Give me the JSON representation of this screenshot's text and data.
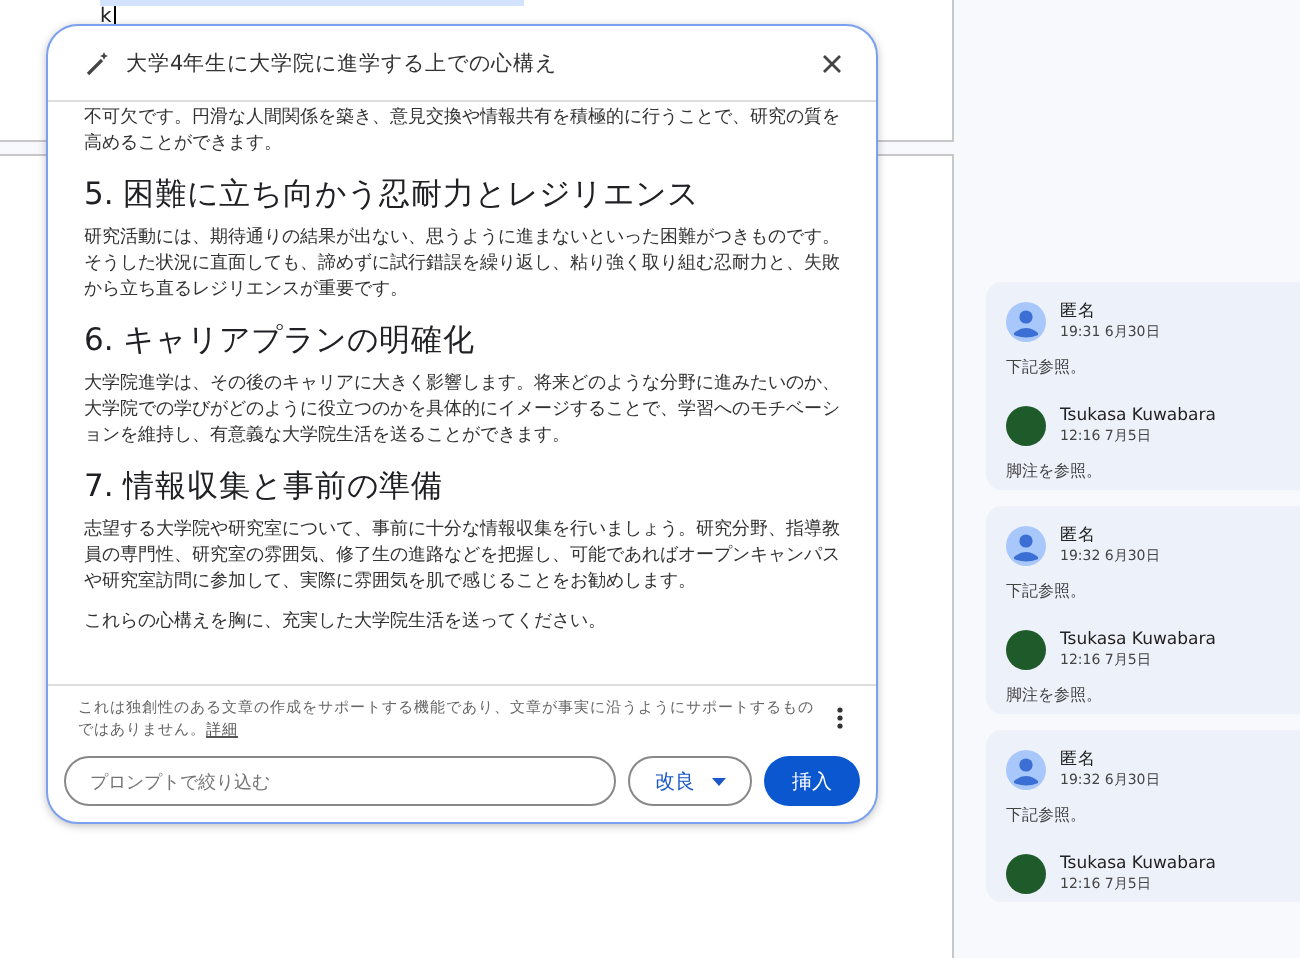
{
  "document": {
    "cursor_text": "k"
  },
  "dialog": {
    "title": "大学4年生に大学院に進学する上での心構え",
    "blocks": [
      {
        "kind": "paragraph",
        "text": "不可欠です。円滑な人間関係を築き、意見交換や情報共有を積極的に行うことで、研究の質を高めることができます。"
      },
      {
        "kind": "heading",
        "text": "5. 困難に立ち向かう忍耐力とレジリエンス"
      },
      {
        "kind": "paragraph",
        "text": "研究活動には、期待通りの結果が出ない、思うように進まないといった困難がつきものです。そうした状況に直面しても、諦めずに試行錯誤を繰り返し、粘り強く取り組む忍耐力と、失敗から立ち直るレジリエンスが重要です。"
      },
      {
        "kind": "heading",
        "text": "6. キャリアプランの明確化"
      },
      {
        "kind": "paragraph",
        "text": "大学院進学は、その後のキャリアに大きく影響します。将来どのような分野に進みたいのか、大学院での学びがどのように役立つのかを具体的にイメージすることで、学習へのモチベーションを維持し、有意義な大学院生活を送ることができます。"
      },
      {
        "kind": "heading",
        "text": "7. 情報収集と事前の準備"
      },
      {
        "kind": "paragraph",
        "text": "志望する大学院や研究室について、事前に十分な情報収集を行いましょう。研究分野、指導教員の専門性、研究室の雰囲気、修了生の進路などを把握し、可能であればオープンキャンパスや研究室訪問に参加して、実際に雰囲気を肌で感じることをお勧めします。"
      },
      {
        "kind": "paragraph",
        "text": "これらの心構えを胸に、充実した大学院生活を送ってください。"
      }
    ],
    "disclaimer": "これは独創性のある文章の作成をサポートする機能であり、文章が事実に沿うようにサポートするものではありません。",
    "disclaimer_link": "詳細",
    "prompt_placeholder": "プロンプトで絞り込む",
    "refine_button": "改良",
    "insert_button": "挿入"
  },
  "threads": [
    {
      "comments": [
        {
          "kind": "anonymous",
          "author": "匿名",
          "time": "19:31 6月30日",
          "text": "下記参照。"
        },
        {
          "kind": "photo",
          "author": "Tsukasa Kuwabara",
          "time": "12:16 7月5日",
          "text": "脚注を参照。"
        }
      ]
    },
    {
      "comments": [
        {
          "kind": "anonymous",
          "author": "匿名",
          "time": "19:32 6月30日",
          "text": "下記参照。"
        },
        {
          "kind": "photo",
          "author": "Tsukasa Kuwabara",
          "time": "12:16 7月5日",
          "text": "脚注を参照。"
        }
      ]
    },
    {
      "comments": [
        {
          "kind": "anonymous",
          "author": "匿名",
          "time": "19:32 6月30日",
          "text": "下記参照。"
        },
        {
          "kind": "photo",
          "author": "Tsukasa Kuwabara",
          "time": "12:16 7月5日"
        }
      ]
    }
  ]
}
